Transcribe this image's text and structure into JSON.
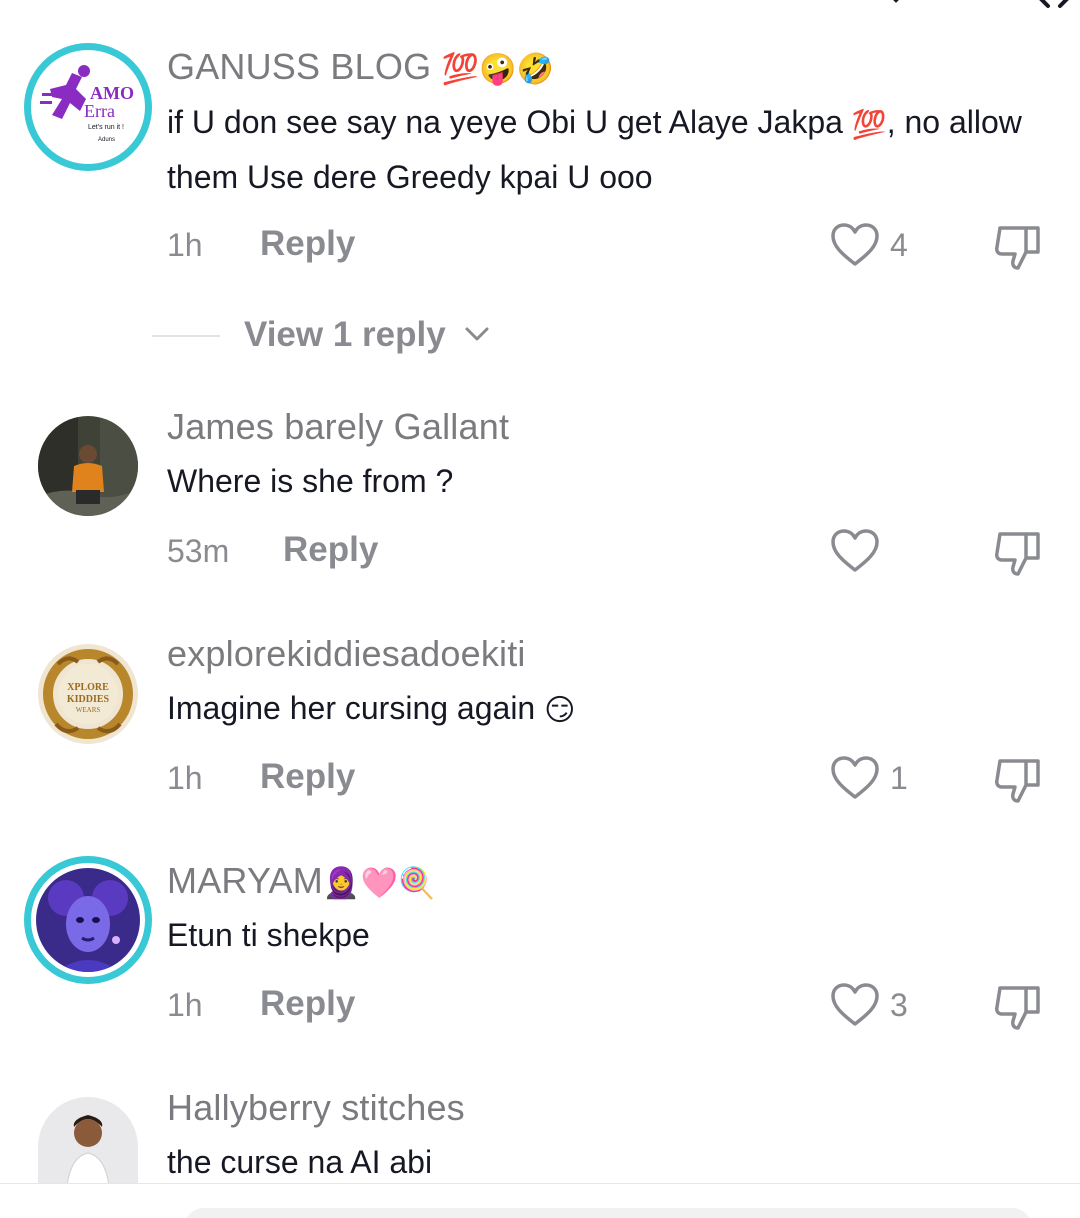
{
  "comments": [
    {
      "username": "GANUSS BLOG",
      "text_before": "if U don see say na yeye Obi U get Alaye Jakpa ",
      "text_after": ", no allow them Use dere Greedy kpai U ooo",
      "time": "1h",
      "reply_label": "Reply",
      "likes": "4",
      "view_replies": "View 1 reply",
      "avatar_text_1": "AMO",
      "avatar_text_2": "Erra",
      "avatar_text_3": "Let's run it !",
      "avatar_text_4": "Aduns"
    },
    {
      "username": "James barely Gallant",
      "text": "Where is she from ?",
      "time": "53m",
      "reply_label": "Reply",
      "likes": ""
    },
    {
      "username": "explorekiddiesadoekiti",
      "text": "Imagine her cursing again",
      "time": "1h",
      "reply_label": "Reply",
      "likes": "1",
      "avatar_text_1": "XPLORE",
      "avatar_text_2": "KIDDIES",
      "avatar_text_3": "WEARS"
    },
    {
      "username": "MARYAM",
      "text": "Etun ti shekpe",
      "time": "1h",
      "reply_label": "Reply",
      "likes": "3"
    },
    {
      "username": "Hallyberry stitches",
      "text": "the curse na AI abi"
    }
  ],
  "emoji": {
    "hundred": "💯",
    "zany": "🤪",
    "rofl": "🤣",
    "smirk": "😏",
    "hijab": "🧕",
    "heart": "🩷",
    "lollipop": "🍭"
  },
  "colors": {
    "ring": "#38c8d6",
    "username": "#7a7a7f",
    "meta": "#8a8b91",
    "text": "#161823",
    "hundred": "#e0245e"
  },
  "icons": {
    "like": "heart-outline-icon",
    "dislike": "thumbs-down-icon",
    "expand": "chevron-down-icon"
  }
}
